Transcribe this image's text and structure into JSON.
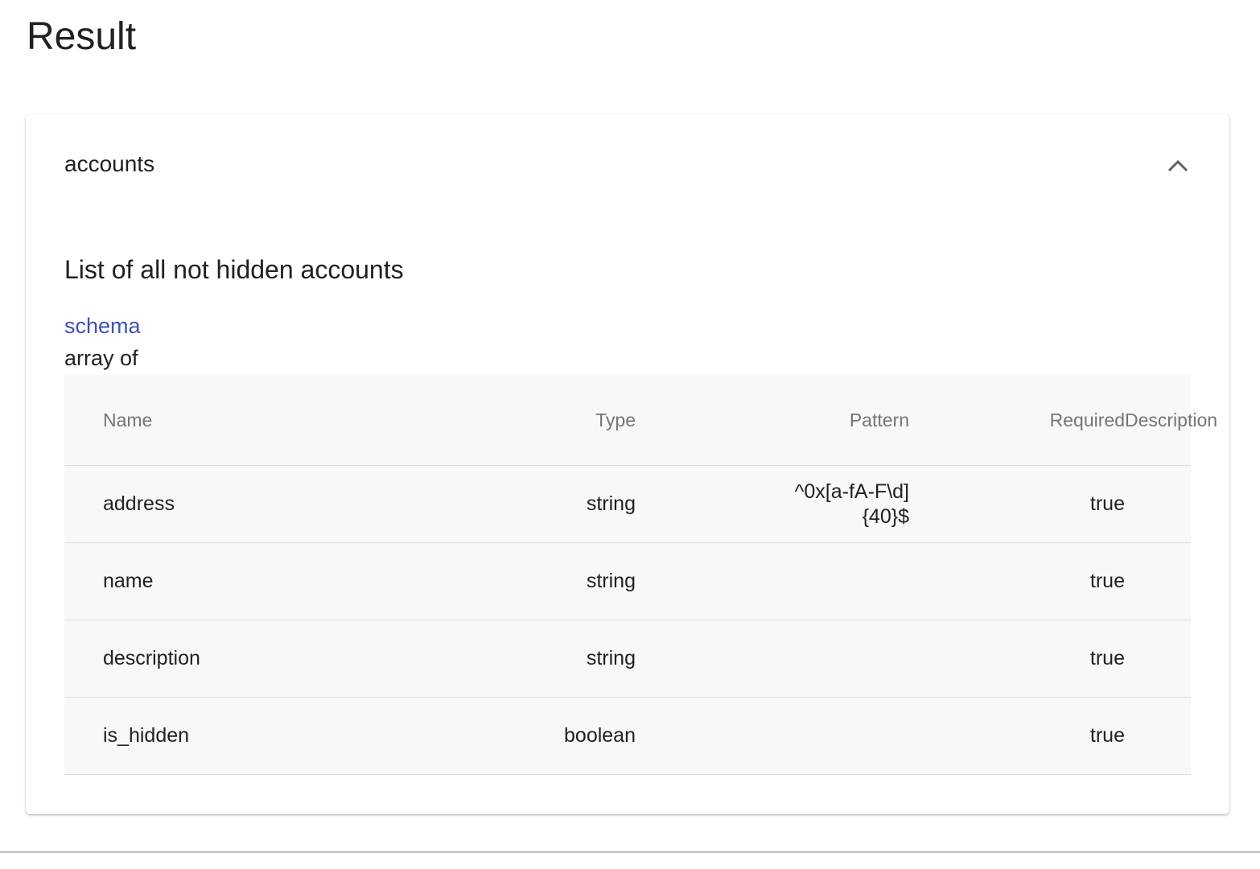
{
  "page": {
    "title": "Result"
  },
  "panel": {
    "header_label": "accounts",
    "expanded": true,
    "section_title": "List of all not hidden accounts",
    "schema_link": "schema",
    "array_of_label": "array of"
  },
  "table": {
    "headers": {
      "name": "Name",
      "type": "Type",
      "pattern": "Pattern",
      "required": "Required",
      "description": "Description"
    },
    "rows": [
      {
        "name": "address",
        "type": "string",
        "pattern": "^0x[a-fA-F\\d]{40}$",
        "required": "true",
        "description": ""
      },
      {
        "name": "name",
        "type": "string",
        "pattern": "",
        "required": "true",
        "description": ""
      },
      {
        "name": "description",
        "type": "string",
        "pattern": "",
        "required": "true",
        "description": ""
      },
      {
        "name": "is_hidden",
        "type": "boolean",
        "pattern": "",
        "required": "true",
        "description": ""
      }
    ]
  },
  "icons": {
    "collapse": "chevron-up-icon"
  },
  "colors": {
    "link": "#3f51b5",
    "table_background": "#f8f8f8",
    "header_text": "#757575"
  }
}
